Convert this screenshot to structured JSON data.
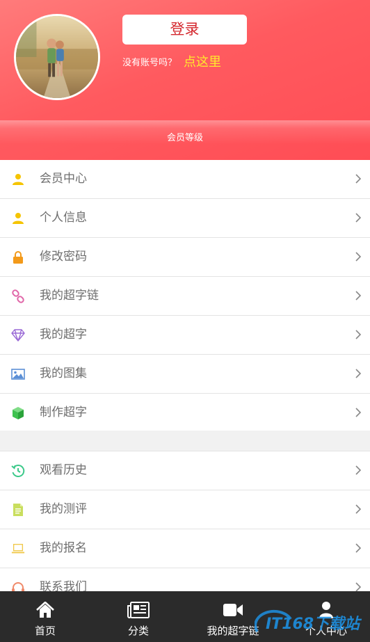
{
  "header": {
    "login_label": "登录",
    "no_account_text": "没有账号吗？",
    "register_link": "点这里",
    "member_level": "会员等级"
  },
  "menu_group_1": [
    {
      "label": "会员中心",
      "icon": "user-icon",
      "color": "#f5c400"
    },
    {
      "label": "个人信息",
      "icon": "user-icon",
      "color": "#f5c400"
    },
    {
      "label": "修改密码",
      "icon": "lock-icon",
      "color": "#f39a1a"
    },
    {
      "label": "我的超字链",
      "icon": "link-icon",
      "color": "#e066a8"
    },
    {
      "label": "我的超字",
      "icon": "diamond-icon",
      "color": "#9a6ad6"
    },
    {
      "label": "我的图集",
      "icon": "image-icon",
      "color": "#5b8fd6"
    },
    {
      "label": "制作超字",
      "icon": "cube-icon",
      "color": "#3fc24f"
    }
  ],
  "menu_group_2": [
    {
      "label": "观看历史",
      "icon": "history-icon",
      "color": "#3cc98a"
    },
    {
      "label": "我的测评",
      "icon": "document-icon",
      "color": "#b8d24a"
    },
    {
      "label": "我的报名",
      "icon": "laptop-icon",
      "color": "#f0c84a"
    },
    {
      "label": "联系我们",
      "icon": "headset-icon",
      "color": "#f08a6a"
    }
  ],
  "tabbar": [
    {
      "label": "首页",
      "icon": "home-icon"
    },
    {
      "label": "分类",
      "icon": "newspaper-icon"
    },
    {
      "label": "我的超字链",
      "icon": "video-camera-icon"
    },
    {
      "label": "个人中心",
      "icon": "person-icon"
    }
  ],
  "watermark": {
    "text": "IT168下载站",
    "color": "#1d8fe0"
  },
  "colors": {
    "header": "#ff5a5f",
    "tabbar": "#2b2b2b",
    "accent_link": "#ffea2c",
    "login_text": "#d4282e"
  }
}
